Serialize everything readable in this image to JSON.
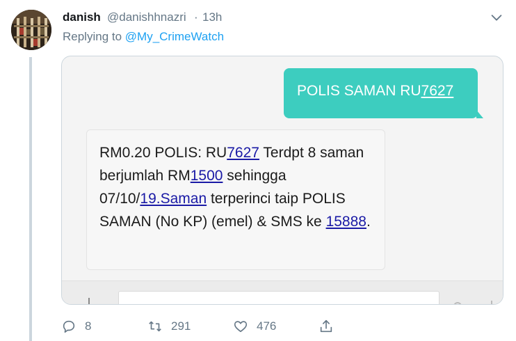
{
  "tweet": {
    "display_name": "danish",
    "handle": "@danishhnazri",
    "separator": "·",
    "time": "13h",
    "replying_prefix": "Replying to ",
    "replying_to": "@My_CrimeWatch"
  },
  "sms": {
    "sent_prefix": "POLIS SAMAN RU",
    "sent_code": "7627",
    "received": {
      "p1": "RM0.20 POLIS: RU",
      "link1": "7627",
      "p2": " Terdpt 8 saman berjumlah RM",
      "link2": "1500",
      "p3": " sehingga 07/10/",
      "link3": "19.Saman",
      "p4": " terperinci taip POLIS SAMAN (No KP) (emel) & SMS ke ",
      "link4": "15888",
      "p5": "."
    }
  },
  "actions": {
    "replies": "8",
    "retweets": "291",
    "likes": "476"
  },
  "colors": {
    "accent": "#1da1f2",
    "sms_bubble": "#3dcdbf",
    "muted": "#657786"
  },
  "icons": [
    "avatar-image",
    "chevron-down-icon",
    "reply-icon",
    "retweet-icon",
    "like-icon",
    "share-icon"
  ]
}
